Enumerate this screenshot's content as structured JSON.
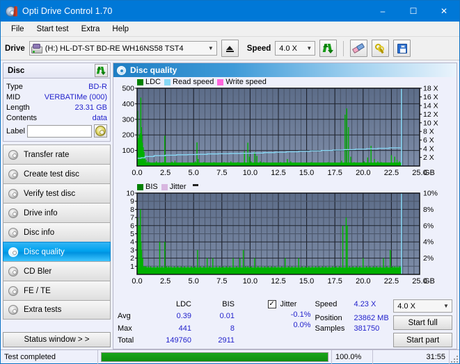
{
  "window": {
    "title": "Opti Drive Control 1.70",
    "icon": "disc-icon",
    "minimize": "–",
    "maximize": "☐",
    "close": "✕"
  },
  "menu": {
    "items": [
      "File",
      "Start test",
      "Extra",
      "Help"
    ]
  },
  "toolbar": {
    "drive_label": "Drive",
    "drive_value": "(H:)  HL-DT-ST BD-RE  WH16NS58 TST4",
    "eject_title": "Eject",
    "speed_label": "Speed",
    "speed_value": "4.0 X",
    "refresh_title": "refresh-icon",
    "erase_title": "erase-icon",
    "tools_title": "tools-icon",
    "save_title": "save-icon"
  },
  "disc": {
    "header": "Disc",
    "rows": [
      {
        "key": "Type",
        "value": "BD-R"
      },
      {
        "key": "MID",
        "value": "VERBATIMe (000)"
      },
      {
        "key": "Length",
        "value": "23.31 GB"
      },
      {
        "key": "Contents",
        "value": "data"
      }
    ],
    "label_key": "Label",
    "label_value": ""
  },
  "nav": {
    "items": [
      {
        "label": "Transfer rate",
        "active": false
      },
      {
        "label": "Create test disc",
        "active": false
      },
      {
        "label": "Verify test disc",
        "active": false
      },
      {
        "label": "Drive info",
        "active": false
      },
      {
        "label": "Disc info",
        "active": false
      },
      {
        "label": "Disc quality",
        "active": true
      },
      {
        "label": "CD Bler",
        "active": false
      },
      {
        "label": "FE / TE",
        "active": false
      },
      {
        "label": "Extra tests",
        "active": false
      }
    ],
    "status_window": "Status window > >"
  },
  "panel": {
    "title": "Disc quality"
  },
  "stats": {
    "col_headers": [
      "LDC",
      "BIS"
    ],
    "row_labels": [
      "Avg",
      "Max",
      "Total"
    ],
    "ldc": {
      "avg": "0.39",
      "max": "441",
      "total": "149760"
    },
    "bis": {
      "avg": "0.01",
      "max": "8",
      "total": "2911"
    },
    "jitter": {
      "label": "Jitter",
      "checked": true,
      "check_mark": "✓",
      "avg": "-0.1%",
      "max": "0.0%"
    },
    "speed_label": "Speed",
    "speed_value": "4.23 X",
    "position_label": "Position",
    "position_value": "23862 MB",
    "samples_label": "Samples",
    "samples_value": "381750",
    "speed_select": "4.0 X",
    "start_full": "Start full",
    "start_part": "Start part"
  },
  "statusbar": {
    "message": "Test completed",
    "percent_text": "100.0%",
    "percent_value": 100,
    "time": "31:55"
  },
  "colors": {
    "accent": "#0078d7",
    "ldc_green": "#00b000",
    "read_speed": "#87d8f5",
    "write_speed": "#ff66dd",
    "jitter": "#d8b6e0",
    "plot_bg": "#6d7d99",
    "value_blue": "#2222cc"
  },
  "chart_data": [
    {
      "type": "line",
      "name": "disc-quality-ldc",
      "title": "LDC",
      "legend": [
        {
          "label": "LDC",
          "color": "#008000"
        },
        {
          "label": "Read speed",
          "color": "#87d8f5"
        },
        {
          "label": "Write speed",
          "color": "#ff66dd"
        }
      ],
      "legend_position": "top-left",
      "xlabel": "GB",
      "xlim": [
        0,
        25.0
      ],
      "xticks": [
        "0.0",
        "2.5",
        "5.0",
        "7.5",
        "10.0",
        "12.5",
        "15.0",
        "17.5",
        "20.0",
        "22.5",
        "25.0"
      ],
      "ylabel_left": "LDC",
      "ylim": [
        0,
        500
      ],
      "yticks_left": [
        "100",
        "200",
        "300",
        "400",
        "500"
      ],
      "ylabel_right": "Speed",
      "ylim_right": [
        0,
        18
      ],
      "yticks_right": [
        "2 X",
        "4 X",
        "6 X",
        "8 X",
        "10 X",
        "12 X",
        "14 X",
        "16 X",
        "18 X"
      ],
      "grid": true,
      "series": [
        {
          "name": "LDC",
          "color": "#00b000",
          "kind": "impulse",
          "x": [
            0.05,
            0.12,
            0.2,
            0.28,
            0.33,
            0.38,
            0.42,
            0.48,
            0.55,
            0.62,
            0.7,
            0.8,
            0.95,
            1.1,
            1.3,
            1.5,
            1.7,
            1.9,
            2.1,
            2.3,
            2.45,
            2.5,
            2.7,
            2.9,
            3.1,
            3.35,
            3.6,
            3.8,
            4.0,
            4.3,
            4.6,
            4.9,
            5.15,
            5.3,
            5.4,
            5.6,
            5.9,
            6.2,
            6.5,
            6.8,
            7.1,
            7.4,
            7.7,
            8.0,
            8.3,
            8.6,
            8.9,
            9.2,
            9.5,
            9.8,
            9.95,
            10.1,
            10.4,
            10.6,
            10.9,
            11.2,
            11.5,
            11.8,
            12.1,
            12.4,
            12.7,
            13.0,
            13.3,
            13.6,
            13.9,
            14.2,
            14.5,
            14.8,
            15.1,
            15.4,
            15.7,
            16.0,
            16.3,
            16.6,
            16.9,
            17.2,
            17.5,
            17.8,
            18.1,
            18.4,
            18.55,
            18.7,
            18.9,
            19.2,
            19.5,
            19.8,
            20.1,
            20.4,
            20.7,
            21.0,
            21.3,
            21.6,
            21.9,
            22.2,
            22.5,
            22.8,
            23.0,
            23.2,
            23.4
          ],
          "y": [
            355,
            180,
            200,
            210,
            440,
            250,
            200,
            150,
            120,
            90,
            60,
            40,
            30,
            25,
            22,
            20,
            30,
            18,
            20,
            25,
            195,
            60,
            22,
            20,
            28,
            35,
            20,
            18,
            22,
            20,
            18,
            22,
            30,
            152,
            45,
            20,
            25,
            22,
            20,
            25,
            22,
            20,
            25,
            20,
            30,
            22,
            25,
            18,
            95,
            150,
            60,
            30,
            90,
            65,
            30,
            25,
            20,
            18,
            22,
            20,
            25,
            20,
            45,
            30,
            22,
            20,
            18,
            22,
            20,
            25,
            22,
            18,
            20,
            22,
            25,
            20,
            18,
            22,
            35,
            330,
            370,
            250,
            60,
            25,
            22,
            20,
            30,
            55,
            130,
            45,
            30,
            25,
            22,
            20,
            70,
            60,
            40,
            30,
            25
          ]
        },
        {
          "name": "Read speed",
          "color": "#87d8f5",
          "kind": "step-line",
          "x": [
            0.0,
            0.35,
            0.7,
            1.5,
            2.5,
            3.5,
            4.5,
            5.3,
            6.2,
            7.2,
            8.2,
            9.2,
            10.2,
            11.2,
            12.2,
            13.2,
            14.3,
            15.3,
            16.3,
            17.3,
            18.3,
            19.3,
            20.3,
            21.3,
            22.3,
            23.3
          ],
          "y": [
            1.8,
            1.9,
            2.2,
            2.4,
            2.5,
            2.6,
            2.65,
            2.7,
            2.8,
            2.85,
            2.9,
            2.95,
            3.0,
            3.1,
            3.2,
            3.3,
            3.4,
            3.5,
            3.6,
            3.7,
            3.8,
            3.9,
            4.0,
            4.1,
            4.2,
            4.25
          ],
          "unit": "X"
        },
        {
          "name": "End marker",
          "color": "#87d8f5",
          "kind": "vline",
          "x": [
            23.4
          ]
        }
      ]
    },
    {
      "type": "line",
      "name": "disc-quality-bis",
      "title": "BIS",
      "legend": [
        {
          "label": "BIS",
          "color": "#008000"
        },
        {
          "label": "Jitter",
          "color": "#d8b6e0"
        }
      ],
      "legend_position": "top-left",
      "xlabel": "GB",
      "xlim": [
        0,
        25.0
      ],
      "xticks": [
        "0.0",
        "2.5",
        "5.0",
        "7.5",
        "10.0",
        "12.5",
        "15.0",
        "17.5",
        "20.0",
        "22.5",
        "25.0"
      ],
      "ylabel_left": "BIS",
      "ylim": [
        0,
        10
      ],
      "yticks_left": [
        "1",
        "2",
        "3",
        "4",
        "5",
        "6",
        "7",
        "8",
        "9",
        "10"
      ],
      "ylabel_right": "Jitter",
      "ylim_right": [
        0,
        10
      ],
      "yticks_right": [
        "2%",
        "4%",
        "6%",
        "8%",
        "10%"
      ],
      "grid": true,
      "series": [
        {
          "name": "BIS",
          "color": "#00b000",
          "kind": "impulse",
          "x": [
            0.05,
            0.15,
            0.25,
            0.3,
            0.35,
            0.4,
            0.45,
            0.5,
            0.6,
            0.7,
            0.8,
            1.0,
            1.2,
            1.5,
            1.8,
            2.0,
            2.2,
            2.45,
            2.6,
            2.8,
            3.0,
            3.3,
            3.6,
            3.9,
            4.2,
            4.5,
            4.8,
            5.1,
            5.35,
            5.6,
            5.9,
            6.2,
            6.4,
            6.7,
            7.0,
            7.3,
            7.6,
            7.9,
            8.2,
            8.5,
            8.8,
            9.1,
            9.4,
            9.6,
            9.8,
            10.1,
            10.4,
            10.7,
            11.0,
            11.3,
            11.6,
            11.9,
            12.2,
            12.5,
            12.8,
            13.1,
            13.4,
            13.7,
            14.0,
            14.3,
            14.6,
            14.9,
            15.2,
            15.5,
            15.8,
            16.1,
            16.4,
            16.7,
            17.0,
            17.3,
            17.6,
            17.9,
            18.2,
            18.5,
            18.6,
            18.8,
            19.1,
            19.4,
            19.7,
            20.0,
            20.3,
            20.6,
            20.9,
            21.2,
            21.5,
            21.8,
            22.1,
            22.4,
            22.6,
            22.8,
            23.0,
            23.2,
            23.35
          ],
          "y": [
            7,
            6,
            6,
            8,
            4,
            3,
            2,
            2,
            1,
            1,
            1,
            1,
            1,
            1,
            1,
            4,
            1,
            4,
            1,
            1,
            1,
            1,
            1,
            1,
            1,
            1,
            1,
            1,
            3,
            1,
            1,
            2,
            1,
            2,
            1,
            1,
            1,
            1,
            1,
            2,
            1,
            2,
            3,
            1,
            1,
            1,
            2,
            1,
            1,
            1,
            1,
            1,
            1,
            1,
            1,
            2,
            1,
            1,
            1,
            2,
            1,
            1,
            1,
            1,
            1,
            1,
            1,
            1,
            1,
            1,
            1,
            1,
            6,
            7,
            6,
            1,
            1,
            1,
            1,
            2,
            1,
            1,
            1,
            1,
            1,
            2,
            1,
            3,
            1,
            1,
            1,
            1,
            1
          ]
        },
        {
          "name": "End marker",
          "color": "#87d8f5",
          "kind": "vline",
          "x": [
            23.4
          ]
        }
      ]
    }
  ]
}
